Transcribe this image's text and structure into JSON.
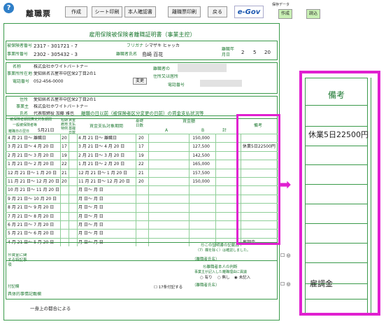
{
  "toolbar": {
    "help_icon": "?",
    "title": "離職票",
    "buttons": [
      "作成",
      "シート印刷",
      "本人確認書",
      "離職票印刷",
      "戻る"
    ],
    "logo": "e-Gov",
    "save_data_label": "保存データ",
    "save_buttons": [
      "作成",
      "読込"
    ]
  },
  "form": {
    "title": "雇用保険被保険者離職証明書（事業主控）",
    "insured_no_label": "被保険者番号",
    "insured_no": "2317 - 301721 - 7",
    "furigana_label": "フリガナ",
    "furigana": "シマザキ ヒャッカ",
    "office_no_label": "事業所番号",
    "office_no": "2302 - 305432 - 3",
    "name_label": "離職者氏名",
    "name": "島崎 百花",
    "leave_date_label": "離職年月日",
    "leave_date": [
      "2",
      "5",
      "20"
    ],
    "employer_rows": [
      {
        "label": "名称",
        "value": "株式会社ホワイトパートナー"
      },
      {
        "label": "事業所所在地",
        "value": "愛知県名古屋市中区栄2丁目2の1"
      },
      {
        "label": "電話番号",
        "value": "052-456-0000"
      }
    ],
    "change_button": "変更",
    "leaver_addr_label": "離職者の",
    "leaver_addr_label2": "住所又は居所",
    "leaver_tel_label": "電話番号",
    "owner_rows": [
      {
        "label": "住所",
        "value": "愛知県名古屋市中区栄2丁目2の1"
      },
      {
        "label": "事業主",
        "value": "株式会社ホワイトパートナー"
      },
      {
        "label": "氏名",
        "value": "代表取締役 加藤 雅也"
      }
    ],
    "wage_header": "離職の日以前（被保険者区分変更の日前）の賃金支払状況等",
    "col_period_label": "被保険者期間算定対象期間",
    "col_general": "一般被保険者等",
    "col_day_after": "離職日の翌日",
    "col_day_after_value": "5月21日",
    "col_pay_days": "賃金支払基礎日数",
    "col_short_count": "短期雇用特例",
    "col_pay_period": "賃金支払対象期間",
    "col_base_days": "基礎日数",
    "col_wage": "賃金額",
    "col_a": "A",
    "col_b": "B",
    "col_total": "計",
    "col_remarks": "備考",
    "rows": [
      {
        "p": "4 月 21 日～  離職日",
        "d": "20",
        "w": "4 月 21 日～  離職日",
        "b": "20",
        "amt": "150,000",
        "rm": ""
      },
      {
        "p": "3 月 21 日～ 4 月 20 日",
        "d": "17",
        "w": "3 月 21 日～ 4 月 20 日",
        "b": "17",
        "amt": "127,500",
        "rm": "休業5日22500円"
      },
      {
        "p": "2 月 21 日～ 3 月 20 日",
        "d": "19",
        "w": "2 月 21 日～ 3 月 20 日",
        "b": "19",
        "amt": "142,500",
        "rm": ""
      },
      {
        "p": "1 月 21 日～ 2 月 20 日",
        "d": "22",
        "w": "1 月 21 日～ 2 月 20 日",
        "b": "22",
        "amt": "165,000",
        "rm": ""
      },
      {
        "p": "12 月 21 日～ 1 月 20 日",
        "d": "21",
        "w": "12 月 21 日～ 1 月 20 日",
        "b": "21",
        "amt": "157,500",
        "rm": ""
      },
      {
        "p": "11 月 21 日～ 12 月 20 日",
        "d": "20",
        "w": "11 月 21 日～ 12 月 20 日",
        "b": "20",
        "amt": "150,000",
        "rm": ""
      },
      {
        "p": "10 月 21 日～ 11 月 20 日",
        "d": "",
        "w": "月  日～  月  日",
        "b": "",
        "amt": "",
        "rm": ""
      },
      {
        "p": "9 月 21 日～ 10 月 20 日",
        "d": "",
        "w": "月  日～  月  日",
        "b": "",
        "amt": "",
        "rm": ""
      },
      {
        "p": "8 月 21 日～ 9 月 20 日",
        "d": "",
        "w": "月  日～  月  日",
        "b": "",
        "amt": "",
        "rm": ""
      },
      {
        "p": "7 月 21 日～ 8 月 20 日",
        "d": "",
        "w": "月  日～  月  日",
        "b": "",
        "amt": "",
        "rm": ""
      },
      {
        "p": "6 月 21 日～ 7 月 20 日",
        "d": "",
        "w": "月  日～  月  日",
        "b": "",
        "amt": "",
        "rm": ""
      },
      {
        "p": "5 月 21 日～ 6 月 20 日",
        "d": "",
        "w": "月  日～  月  日",
        "b": "",
        "amt": "",
        "rm": ""
      },
      {
        "p": "4 月 21 日～ 5 月 20 日",
        "d": "",
        "w": "月  日～  月  日",
        "b": "",
        "amt": "",
        "rm": "雇調金"
      }
    ],
    "wage_note_label": "⑭賃金に関する特記事項",
    "confirm_title": "⑮この証明書の記載は",
    "confirm_sub": "（7）欄を除く）は確認しました。",
    "leaver_name_label": "（離職者氏名）",
    "judge_title": "⑯離職者本人の判断",
    "judge_sub": "事業主が記入した離職理由に異議",
    "judge_options": [
      "有り",
      "無し",
      "未記入"
    ],
    "remarks_col_label": "付記欄",
    "check17": "17条付記する",
    "reason_label": "具体的事情記載欄",
    "reason_text": "一身上の都合による"
  },
  "zoom": {
    "header": "備考",
    "cell1": "休業5日22500円",
    "cell2": "雇調金",
    "arrow": "➡"
  }
}
